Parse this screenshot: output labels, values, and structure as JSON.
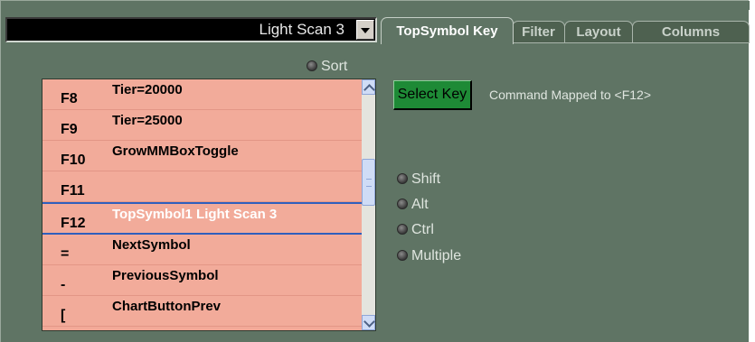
{
  "scan_select": {
    "value": "Light Scan 3"
  },
  "tabs": [
    {
      "label": "TopSymbol Key",
      "active": true
    },
    {
      "label": "Filter",
      "active": false
    },
    {
      "label": "Layout",
      "active": false
    },
    {
      "label": "Columns",
      "active": false
    }
  ],
  "sort": {
    "label": "Sort"
  },
  "key_list": {
    "rows": [
      {
        "key": "F8",
        "command": "Tier=20000"
      },
      {
        "key": "F9",
        "command": "Tier=25000"
      },
      {
        "key": "F10",
        "command": "GrowMMBoxToggle"
      },
      {
        "key": "F11",
        "command": ""
      },
      {
        "key": "F12",
        "command": "TopSymbol1 Light Scan 3",
        "selected": true
      },
      {
        "key": "=",
        "command": "NextSymbol"
      },
      {
        "key": "-",
        "command": "PreviousSymbol"
      },
      {
        "key": "[",
        "command": "ChartButtonPrev"
      }
    ]
  },
  "select_key_button": {
    "label": "Select Key"
  },
  "mapped_text": "Command Mapped to <F12>",
  "modifiers": {
    "shift": "Shift",
    "alt": "Alt",
    "ctrl": "Ctrl",
    "multiple": "Multiple"
  },
  "colors": {
    "panel_bg": "#5f7464",
    "row_bg": "#f2ab9a",
    "selected_border": "#2f5fbd",
    "button_green": "#1e8a36"
  }
}
